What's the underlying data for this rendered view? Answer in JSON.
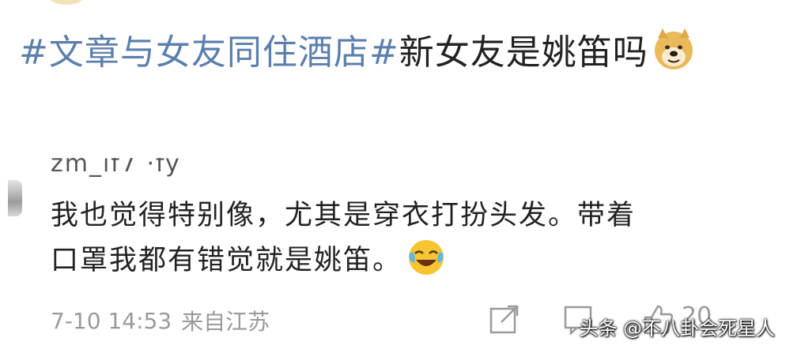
{
  "post": {
    "hashtag": "#文章与女友同住酒店#",
    "text": "新女友是姚笛吗",
    "emoji": "doge-emoji"
  },
  "comment": {
    "username": "zm_if7 ·fy",
    "lines": [
      "我也觉得特别像，尤其是穿衣打扮头发。带着",
      "口罩我都有错觉就是姚笛。"
    ],
    "emoji": "laugh-cry-emoji",
    "time": "7-10 14:53",
    "source": "来自江苏",
    "like_count": "20"
  },
  "icons": {
    "share": "share-icon",
    "comment": "comment-icon",
    "like": "thumbs-up-icon"
  },
  "watermark": "头条 @不八卦会死星人",
  "colors": {
    "hashtag": "#5b7fad",
    "meta": "#9a9a9a",
    "text": "#222222"
  }
}
